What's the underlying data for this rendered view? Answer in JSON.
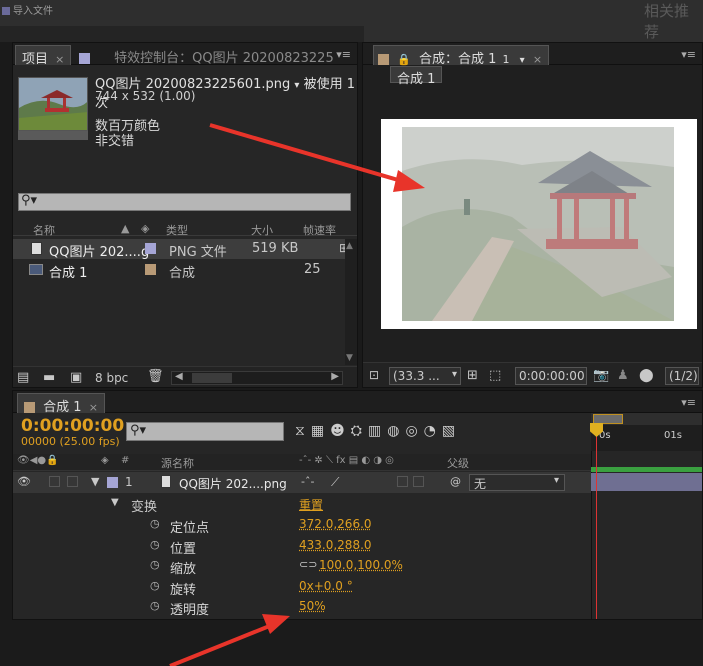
{
  "background": {
    "dialog_title": "导入文件",
    "right_text": "相关推荐"
  },
  "project_panel": {
    "tab_project": "项目",
    "tab_close": "×",
    "tab_effects": "特效控制台：QQ图片 20200823225",
    "menu": "▾≡",
    "file_name": "QQ图片 20200823225601.png",
    "usage": "被使用 1次",
    "dimensions": "744 x 532 (1.00)",
    "color_depth": "数百万颜色",
    "interlace": "非交错",
    "columns": {
      "name": "名称",
      "type": "类型",
      "size": "大小",
      "fps": "帧速率"
    },
    "items": [
      {
        "name": "QQ图片 202....g",
        "type": "PNG 文件",
        "size": "519 KB",
        "fps": "",
        "color": "#a5a5d5",
        "selected": true
      },
      {
        "name": "合成 1",
        "type": "合成",
        "size": "",
        "fps": "25",
        "color": "#b89a76",
        "selected": false
      }
    ],
    "bpc": "8 bpc"
  },
  "comp_panel": {
    "tab_label": "合成：合成 1",
    "tab_close": "×",
    "menu": "▾≡",
    "sub_tab": "合成 1",
    "zoom": "(33.3 ...",
    "timecode": "0:00:00:00",
    "resolution": "(1/2)"
  },
  "timeline": {
    "tab_label": "合成 1",
    "tab_close": "×",
    "menu": "▾≡",
    "current_time": "0:00:00:00",
    "fps": "00000 (25.00 fps)",
    "header_layer_name": "源名称",
    "header_parent": "父级",
    "layer": {
      "index": "1",
      "name": "QQ图片 202....png",
      "parent": "无"
    },
    "transform_label": "变换",
    "transform_reset": "重置",
    "properties": [
      {
        "name": "定位点",
        "value": "372.0,266.0"
      },
      {
        "name": "位置",
        "value": "433.0,288.0"
      },
      {
        "name": "缩放",
        "value": "100.0,100.0%"
      },
      {
        "name": "旋转",
        "value": "0x+0.0 °"
      },
      {
        "name": "透明度",
        "value": "50%"
      }
    ],
    "ruler_start": "0s",
    "ruler_end": "01s"
  },
  "colors": {
    "accent_orange": "#e0a020",
    "annotation_red": "#e8342a",
    "layer_label": "#a5a5d5",
    "comp_label": "#b89a76"
  }
}
